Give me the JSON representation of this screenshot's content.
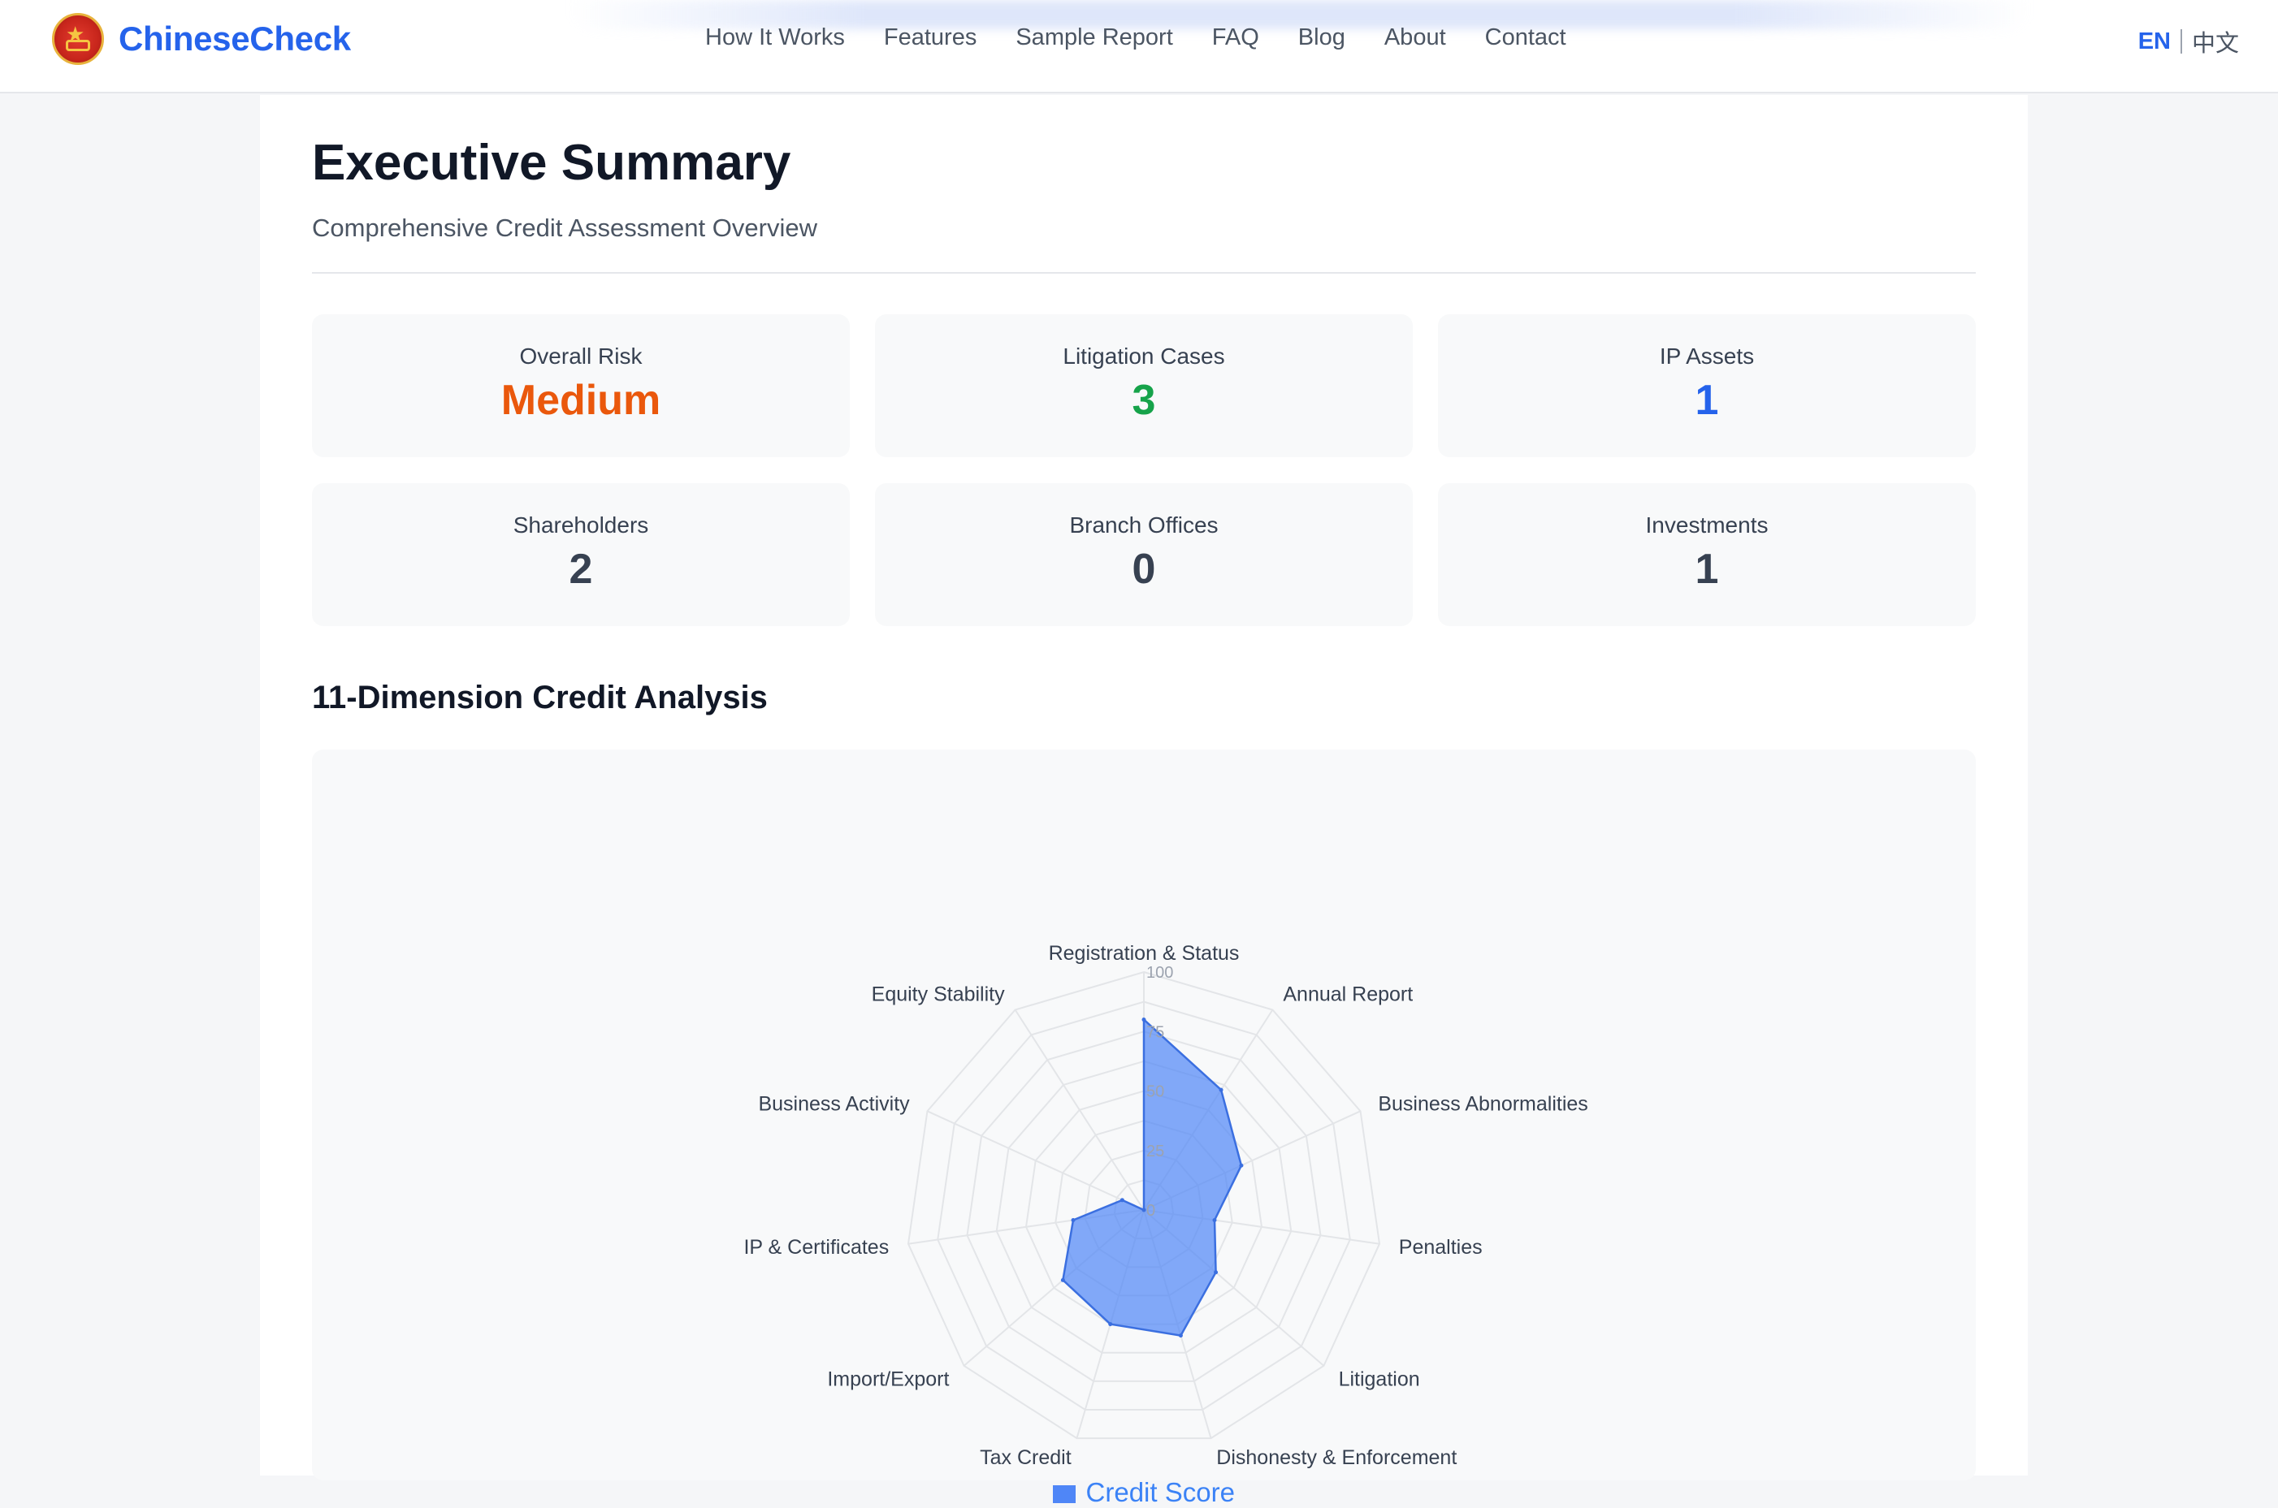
{
  "header": {
    "brand": "ChineseCheck",
    "nav": [
      "How It Works",
      "Features",
      "Sample Report",
      "FAQ",
      "Blog",
      "About",
      "Contact"
    ],
    "lang_en": "EN",
    "lang_zh": "中文"
  },
  "summary": {
    "title": "Executive Summary",
    "subtitle": "Comprehensive Credit Assessment Overview",
    "stats": [
      {
        "label": "Overall Risk",
        "value": "Medium"
      },
      {
        "label": "Litigation Cases",
        "value": "3"
      },
      {
        "label": "IP Assets",
        "value": "1"
      },
      {
        "label": "Shareholders",
        "value": "2"
      },
      {
        "label": "Branch Offices",
        "value": "0"
      },
      {
        "label": "Investments",
        "value": "1"
      }
    ]
  },
  "analysis": {
    "title": "11-Dimension Credit Analysis"
  },
  "colors": {
    "accent": "#2563eb",
    "risk_medium": "#ea580c",
    "ok_green": "#16a34a",
    "radar_fill": "#4f86f7"
  },
  "chart_data": {
    "type": "radar",
    "categories": [
      "Registration & Status",
      "Annual Report",
      "Business Abnormalities",
      "Penalties",
      "Litigation",
      "Dishonesty & Enforcement",
      "Tax Credit",
      "Import/Export",
      "IP & Certificates",
      "Business Activity",
      "Equity Stability"
    ],
    "series": [
      {
        "name": "Credit Score",
        "values": [
          80,
          60,
          45,
          30,
          40,
          55,
          50,
          45,
          30,
          10,
          0
        ]
      }
    ],
    "ticks": [
      "0",
      "25",
      "50",
      "75",
      "100"
    ],
    "rmax": 100,
    "legend": "bottom-center"
  }
}
